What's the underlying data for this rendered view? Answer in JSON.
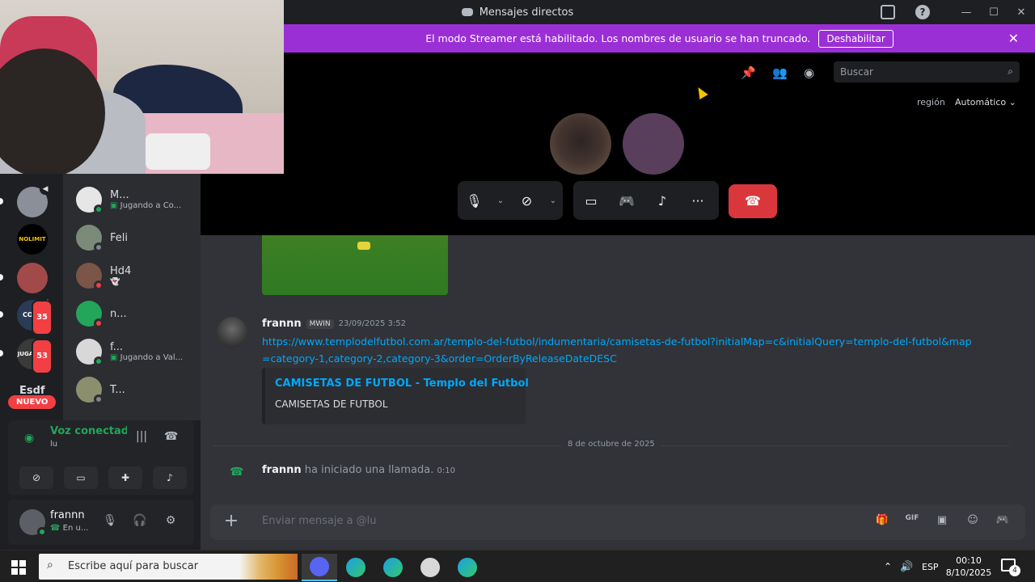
{
  "window": {
    "title": "Mensajes directos",
    "controls": [
      "—",
      "☐",
      "✕"
    ]
  },
  "banner": {
    "text": "El modo Streamer está habilitado. Los nombres de usuario se han truncado.",
    "button": "Deshabilitar"
  },
  "servers": [
    {
      "badge": ""
    },
    {
      "label": "NOLIMIT",
      "badge": ""
    },
    {
      "badge": ""
    },
    {
      "label": "COPE",
      "badge": "35"
    },
    {
      "label": "JUGADOR",
      "badge": "53"
    }
  ],
  "servers_tail": {
    "nuevo": "NUEVO",
    "partial": "Esdf"
  },
  "dms": [
    {
      "name": "M...",
      "sub": "Jugando a Co..."
    },
    {
      "name": "Feli",
      "sub": ""
    },
    {
      "name": "Hd4",
      "sub": ""
    },
    {
      "name": "n...",
      "sub": ""
    },
    {
      "name": "f...",
      "sub": "Jugando a Val..."
    },
    {
      "name": "T...",
      "sub": ""
    }
  ],
  "voice": {
    "title": "Voz conectada",
    "channel": "lu"
  },
  "user": {
    "name": "frannn",
    "status": "En u..."
  },
  "call": {
    "search_placeholder": "Buscar",
    "region_label": "región",
    "region_value": "Automático"
  },
  "chat": {
    "message": {
      "author": "frannn",
      "tag": "MWIN",
      "time": "23/09/2025 3:52",
      "link": "https://www.templodelfutbol.com.ar/templo-del-futbol/indumentaria/camisetas-de-futbol?initialMap=c&initialQuery=templo-del-futbol&map=category-1,category-2,category-3&order=OrderByReleaseDateDESC",
      "embed_title": "CAMISETAS DE FUTBOL - Templo del Futbol",
      "embed_desc": "CAMISETAS DE FUTBOL"
    },
    "date_divider": "8 de octubre de 2025",
    "system": {
      "author": "frannn",
      "text": "ha iniciado una llamada.",
      "duration": "0:10"
    },
    "input_placeholder": "Enviar mensaje a @lu"
  },
  "taskbar": {
    "search_placeholder": "Escribe aquí para buscar",
    "lang": "ESP",
    "time": "00:10",
    "date": "8/10/2025",
    "notifications": "4"
  },
  "colors": {
    "banner": "#9b2fd6",
    "end_call": "#da373c",
    "link": "#00a8fc",
    "online": "#23a55a"
  }
}
